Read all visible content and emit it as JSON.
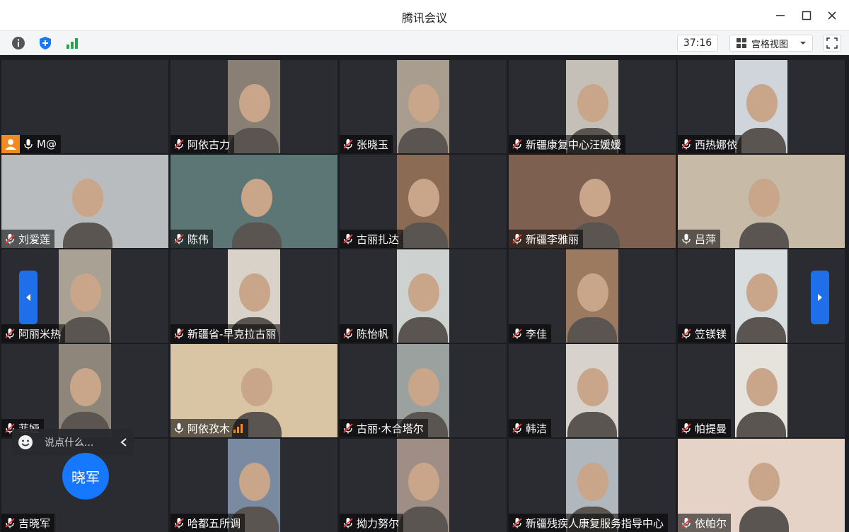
{
  "window": {
    "title": "腾讯会议"
  },
  "toolbar": {
    "timer": "37:16",
    "view_mode": "宫格视图"
  },
  "chat": {
    "placeholder": "说点什么..."
  },
  "speaker_avatar": "晓军",
  "participants": [
    {
      "name": "M@",
      "mic": "on",
      "host": true,
      "video": "dark"
    },
    {
      "name": "阿依古力",
      "mic": "muted",
      "video": "#8a7f74"
    },
    {
      "name": "张晓玉",
      "mic": "muted",
      "video": "#a89d8e"
    },
    {
      "name": "新疆康复中心汪媛媛",
      "mic": "muted",
      "video": "#c4c0b8"
    },
    {
      "name": "西热娜依",
      "mic": "muted",
      "video": "#cfd5da"
    },
    {
      "name": "刘爱莲",
      "mic": "muted",
      "video": "#b8bcbf"
    },
    {
      "name": "陈伟",
      "mic": "muted",
      "video": "#5c7676"
    },
    {
      "name": "古丽扎达",
      "mic": "muted",
      "video": "#8c6b55"
    },
    {
      "name": "新疆李雅丽",
      "mic": "muted",
      "video": "#7d6050"
    },
    {
      "name": "吕萍",
      "mic": "on",
      "video": "#c7bba8"
    },
    {
      "name": "阿丽米热",
      "mic": "muted",
      "video": "#a9a194"
    },
    {
      "name": "新疆省-早克拉古丽",
      "mic": "muted",
      "video": "#d9d2c9"
    },
    {
      "name": "陈怡帆",
      "mic": "muted",
      "video": "#cdd1cf"
    },
    {
      "name": "李佳",
      "mic": "muted",
      "video": "#9b7a60"
    },
    {
      "name": "笠镁镁",
      "mic": "muted",
      "video": "#d8dde0"
    },
    {
      "name": "菲娅",
      "mic": "muted",
      "video": "#8e857b"
    },
    {
      "name": "阿依孜木",
      "mic": "speaking",
      "video": "#d9c4a4"
    },
    {
      "name": "古丽·木合塔尔",
      "mic": "muted",
      "video": "#9aa19e"
    },
    {
      "name": "韩洁",
      "mic": "muted",
      "video": "#d7d3cc"
    },
    {
      "name": "帕提曼",
      "mic": "muted",
      "video": "#e6e2dc"
    },
    {
      "name": "吉晓军",
      "mic": "muted",
      "video": "dark"
    },
    {
      "name": "哈都五所调",
      "mic": "muted",
      "video": "#7a8aa0"
    },
    {
      "name": "拗力努尔",
      "mic": "muted",
      "video": "#9e8e86"
    },
    {
      "name": "新疆残疾人康复服务指导中心",
      "mic": "muted",
      "video": "#b0b7bd"
    },
    {
      "name": "依帕尔",
      "mic": "muted",
      "video": "#e4d3c6"
    }
  ],
  "colors": {
    "accent": "#1677ff",
    "tile_bg": "#2a2c31",
    "signal": "#22a84a",
    "shield": "#1677ff"
  },
  "icons": [
    "info-icon",
    "shield-icon",
    "signal-icon",
    "grid-view-icon",
    "dropdown-icon",
    "fullscreen-icon",
    "emoji-icon",
    "collapse-icon",
    "mic-muted-icon",
    "mic-icon",
    "host-icon",
    "audio-level-icon",
    "chevron-left-icon",
    "chevron-right-icon"
  ]
}
